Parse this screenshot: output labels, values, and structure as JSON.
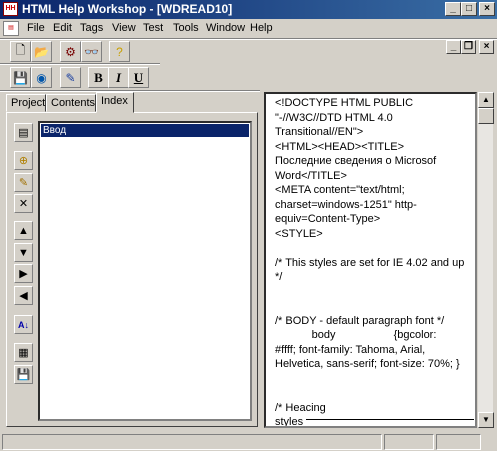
{
  "window": {
    "title": "HTML Help Workshop - [WDREAD10]",
    "app_icon_text": "HH"
  },
  "menu": [
    "File",
    "Edit",
    "Tags",
    "View",
    "Test",
    "Tools",
    "Window",
    "Help"
  ],
  "tabs": [
    "Project",
    "Contents",
    "Index"
  ],
  "format_buttons": {
    "bold": "B",
    "italic": "I",
    "underline": "U"
  },
  "index": {
    "items": [
      "Ввод"
    ]
  },
  "editor": {
    "lines": [
      "<!DOCTYPE HTML PUBLIC",
      "\"-//W3C//DTD HTML 4.0",
      "Transitional//EN\">",
      "<HTML><HEAD><TITLE>",
      "Последние сведения о Microsof",
      "Word</TITLE>",
      "<META content=\"text/html;",
      "charset=windows-1251\" http-",
      "equiv=Content-Type>",
      "<STYLE>",
      "",
      "/* This styles are set for IE 4.02 and up",
      "*/",
      "",
      "",
      "/* BODY - default paragraph font */",
      "            body                   {bgcolor:",
      "#ffff; font-family: Tahoma, Arial,",
      "Helvetica, sans-serif; font-size: 70%; }",
      "",
      "",
      "/* Heacing",
      "styles"
    ]
  }
}
